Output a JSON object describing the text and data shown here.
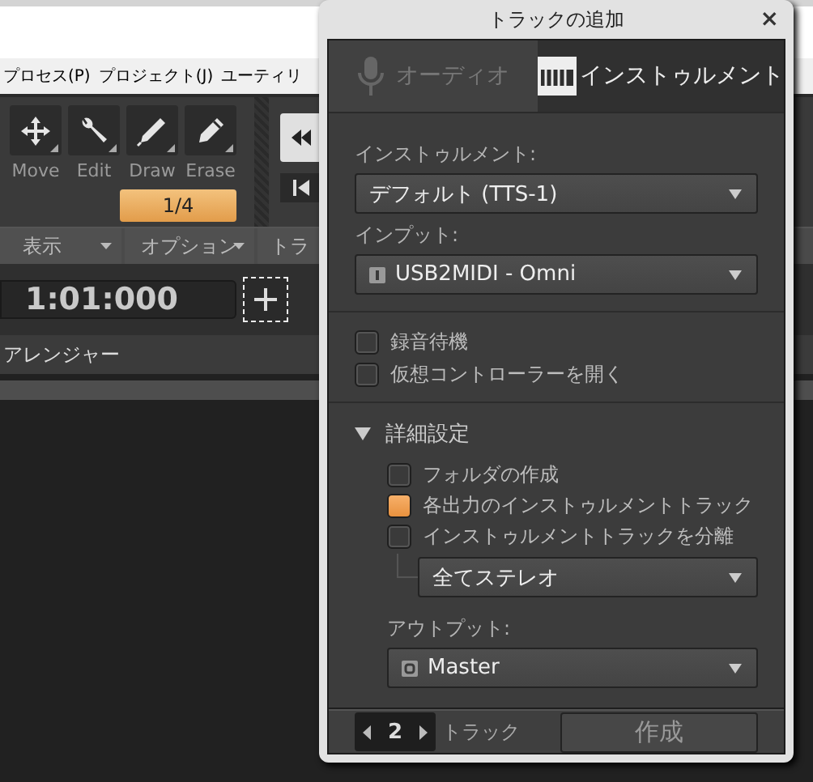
{
  "app": {
    "menu": [
      "プロセス(P)",
      "プロジェクト(J)",
      "ユーティリ"
    ],
    "tools": [
      {
        "label": "Move"
      },
      {
        "label": "Edit"
      },
      {
        "label": "Draw"
      },
      {
        "label": "Erase"
      }
    ],
    "snap": "1/4",
    "view_bar": [
      "表示",
      "オプション",
      "トラ"
    ],
    "time": "1:01:000",
    "arranger": "アレンジャー"
  },
  "dialog": {
    "title": "トラックの追加",
    "close": "×",
    "tabs": [
      {
        "label": "オーディオ",
        "selected": false
      },
      {
        "label": "インストゥルメント",
        "selected": true
      }
    ],
    "fields": [
      {
        "label": "インストゥルメント:",
        "value": "デフォルト (TTS-1)"
      },
      {
        "label": "インプット:",
        "value": "USB2MIDI - Omni"
      }
    ],
    "options": [
      {
        "label": "録音待機",
        "checked": false
      },
      {
        "label": "仮想コントローラーを開く",
        "checked": false
      }
    ],
    "advanced": {
      "label": "詳細設定",
      "expanded": true,
      "options": [
        {
          "label": "フォルダの作成",
          "checked": false
        },
        {
          "label": "各出力のインストゥルメントトラック",
          "checked": true
        },
        {
          "label": "インストゥルメントトラックを分離",
          "checked": false
        }
      ],
      "split_mode": "全てステレオ",
      "output": {
        "label": "アウトプット:",
        "value": "Master"
      }
    },
    "footer": {
      "count": "2",
      "unit": "トラック",
      "create": "作成"
    }
  }
}
